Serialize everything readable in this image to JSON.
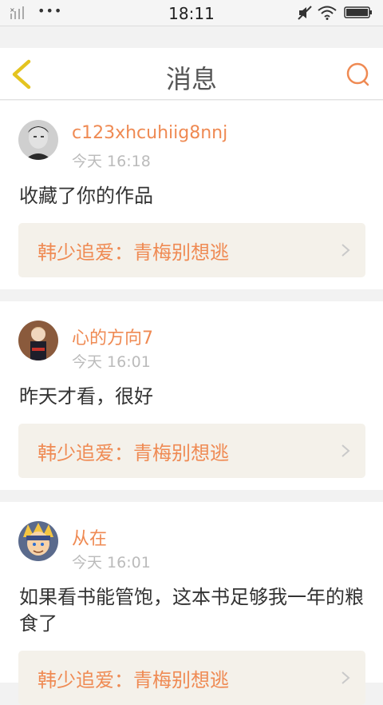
{
  "status_bar": {
    "time": "18:11",
    "dots": "•••",
    "icons": [
      "signal-icon",
      "mute-icon",
      "wifi-icon",
      "battery-icon"
    ]
  },
  "header": {
    "title": "消息",
    "back_icon": "chevron-left-icon",
    "search_icon": "search-icon"
  },
  "colors": {
    "accent": "#ef8a53",
    "back_arrow": "#e4c420",
    "muted_text": "#bbbbbb",
    "book_bg": "#f4f1ea",
    "page_bg": "#f2f2f2"
  },
  "comments": [
    {
      "username": "c123xhcuhiig8nnj",
      "time": "今天 16:18",
      "text": "收藏了你的作品",
      "book_title": "韩少追爱：青梅别想逃",
      "avatar": "avatar-man-photo"
    },
    {
      "username": "心的方向7",
      "time": "今天 16:01",
      "text": "昨天才看，很好",
      "book_title": "韩少追爱：青梅别想逃",
      "avatar": "avatar-child-photo"
    },
    {
      "username": "从在",
      "time": "今天 16:01",
      "text": "如果看书能管饱，这本书足够我一年的粮食了",
      "book_title": "韩少追爱：青梅别想逃",
      "avatar": "avatar-anime-photo"
    }
  ]
}
